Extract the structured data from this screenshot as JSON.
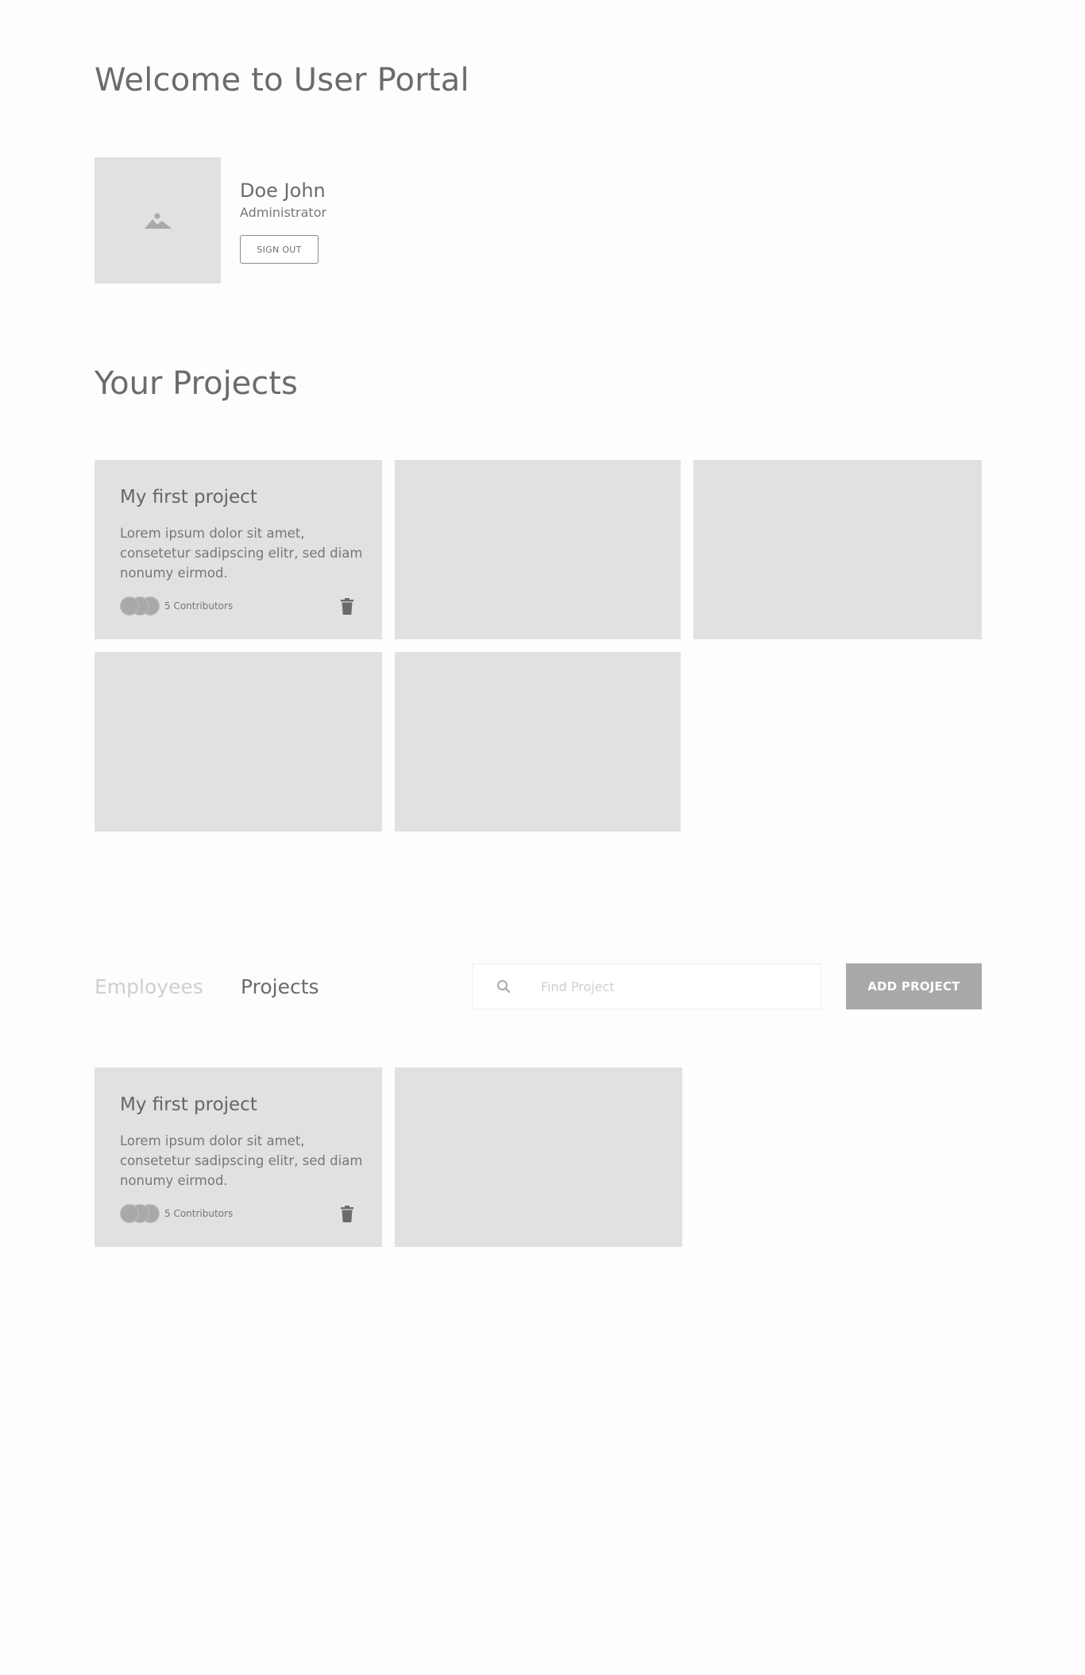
{
  "header": {
    "title": "Welcome to User Portal"
  },
  "profile": {
    "avatar_icon": "image-placeholder-icon",
    "name": "Doe John",
    "role": "Administrator",
    "sign_out_label": "SIGN OUT"
  },
  "projects_section": {
    "title": "Your Projects",
    "cards": [
      {
        "title": "My first project",
        "description": "Lorem ipsum dolor sit amet, consetetur sadipscing elitr, sed diam nonumy eirmod.",
        "contributors_label": "5 Contributors",
        "delete_icon": "trash-icon"
      }
    ]
  },
  "tabs": {
    "items": [
      {
        "label": "Employees",
        "active": false
      },
      {
        "label": "Projects",
        "active": true
      }
    ]
  },
  "search": {
    "icon": "search-icon",
    "value": "",
    "placeholder": "Find Project"
  },
  "toolbar": {
    "add_project_label": "ADD PROJECT"
  },
  "list": {
    "cards": [
      {
        "title": "My first project",
        "description": "Lorem ipsum dolor sit amet, consetetur sadipscing elitr, sed diam nonumy eirmod.",
        "contributors_label": "5 Contributors",
        "delete_icon": "trash-icon"
      }
    ]
  },
  "colors": {
    "card_background": "#e1e1e1",
    "text_primary": "#6b6b6b",
    "tab_inactive": "#cfcfcf",
    "button_background": "#a9a9a9",
    "button_text": "#ffffff"
  }
}
